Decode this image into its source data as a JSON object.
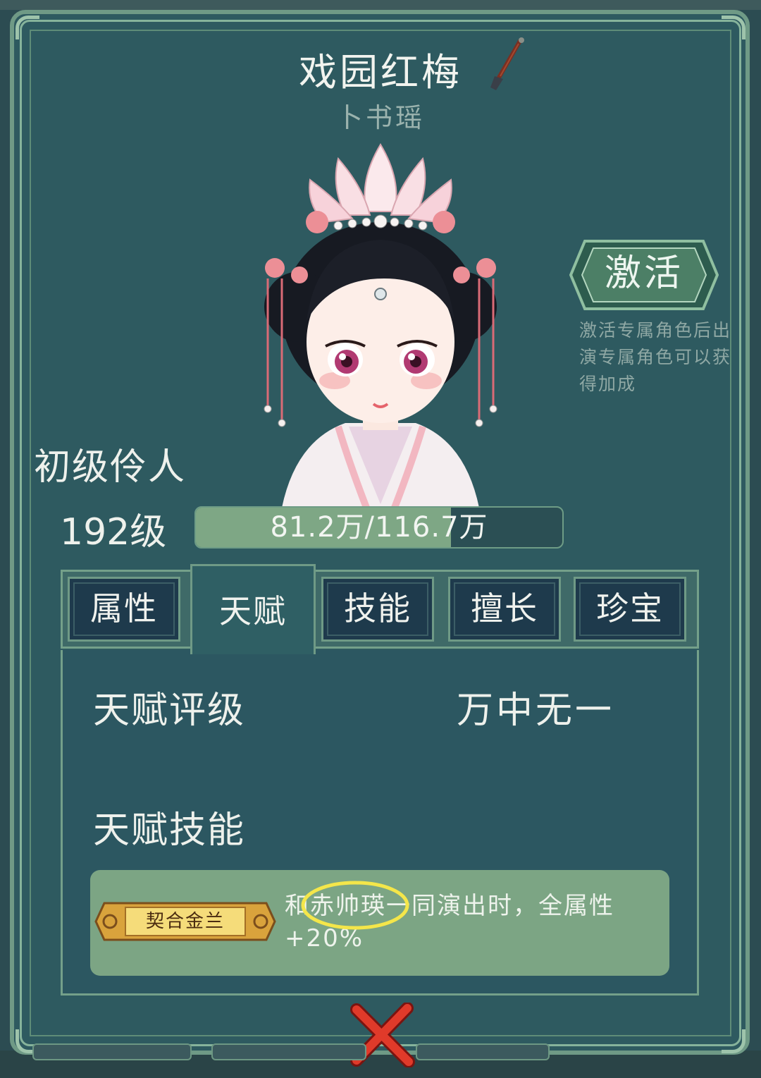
{
  "header": {
    "title": "戏园红梅",
    "subtitle": "卜书瑶"
  },
  "activate": {
    "label": "激活",
    "description": "激活专属角色后出演专属角色可以获得加成"
  },
  "character": {
    "rank": "初级伶人",
    "level": "192级",
    "exp_text": "81.2万/116.7万",
    "exp_current": 81.2,
    "exp_max": 116.7,
    "exp_fraction": 0.696
  },
  "tabs": [
    {
      "label": "属性",
      "active": false
    },
    {
      "label": "天赋",
      "active": true
    },
    {
      "label": "技能",
      "active": false
    },
    {
      "label": "擅长",
      "active": false
    },
    {
      "label": "珍宝",
      "active": false
    }
  ],
  "talent": {
    "grade_label": "天赋评级",
    "grade_value": "万中无一",
    "skill_label": "天赋技能",
    "skill_badge": "契合金兰",
    "skill_description": "和赤帅瑛一同演出时，全属性+20%"
  },
  "colors": {
    "panel": "#2e5a60",
    "frame": "#6f9a86",
    "tab_bg": "#1e3a4c",
    "exp_fill": "#7ea785",
    "skill_box": "#7ca584",
    "highlight": "#f4e64a",
    "close": "#e03a2a"
  },
  "icons": {
    "brush": "brush-icon",
    "close": "close-icon"
  }
}
